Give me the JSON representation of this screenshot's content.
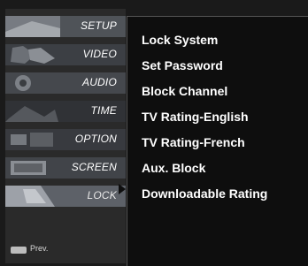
{
  "left_menu": {
    "items": [
      {
        "label": "SETUP",
        "icon": "setup-thumb-icon",
        "color": "#7a7f86"
      },
      {
        "label": "VIDEO",
        "icon": "video-thumb-icon",
        "color": "#5d5f63"
      },
      {
        "label": "AUDIO",
        "icon": "audio-thumb-icon",
        "color": "#6b6e74"
      },
      {
        "label": "TIME",
        "icon": "time-thumb-icon",
        "color": "#4e5055"
      },
      {
        "label": "OPTION",
        "icon": "option-thumb-icon",
        "color": "#5f6166"
      },
      {
        "label": "SCREEN",
        "icon": "screen-thumb-icon",
        "color": "#6a6c72"
      },
      {
        "label": "LOCK",
        "icon": "lock-thumb-icon",
        "color": "#8a8e96",
        "active": true
      }
    ],
    "prev_label": "Prev."
  },
  "submenu": {
    "items": [
      "Lock System",
      "Set Password",
      "Block Channel",
      "TV Rating-English",
      "TV Rating-French",
      "Aux. Block",
      "Downloadable Rating"
    ]
  }
}
